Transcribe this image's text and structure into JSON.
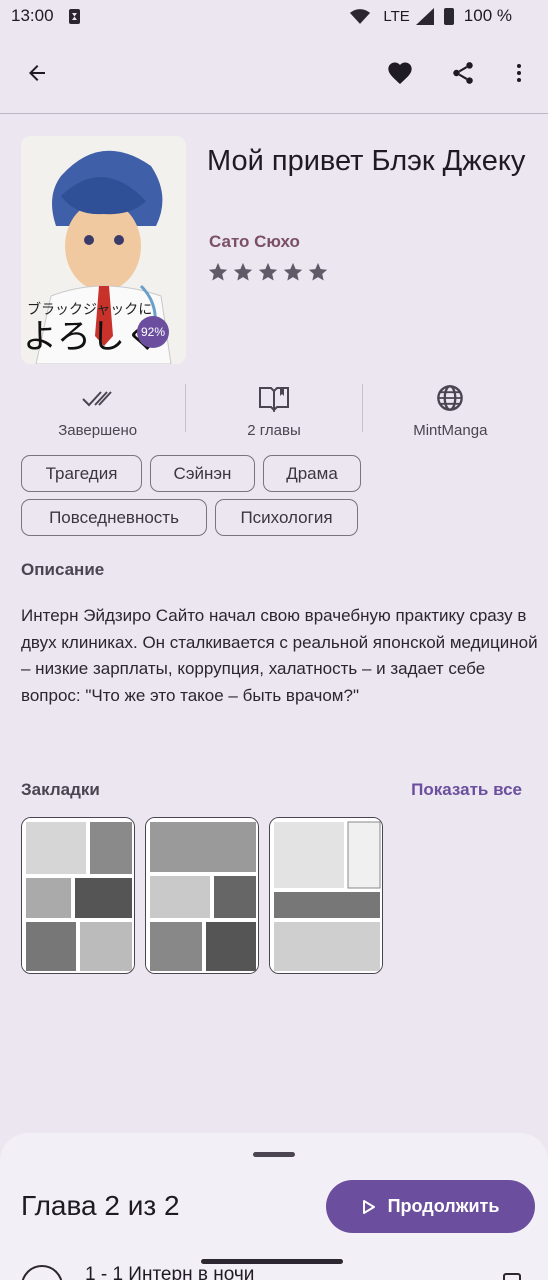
{
  "status_bar": {
    "time": "13:00",
    "network": "LTE",
    "battery": "100 %"
  },
  "app_bar": {
    "icons": [
      "back-arrow-icon",
      "heart-icon",
      "share-icon",
      "more-vert-icon"
    ]
  },
  "manga": {
    "title": "Мой привет Блэк Джеку",
    "author": "Сато Сюхо",
    "rating_stars": 5,
    "read_progress": "92%",
    "cover_text_line1": "ブラックジャックに",
    "cover_text_line2": "よろしく"
  },
  "info": [
    {
      "icon": "double-check-icon",
      "label": "Завершено"
    },
    {
      "icon": "book-icon",
      "label": "2 главы"
    },
    {
      "icon": "globe-icon",
      "label": "MintManga"
    }
  ],
  "genres": [
    "Трагедия",
    "Сэйнэн",
    "Драма",
    "Повседневность",
    "Психология"
  ],
  "description": {
    "label": "Описание",
    "text": "Интерн Эйдзиро Сайто начал свою врачебную практику сразу в двух клиниках. Он сталкивается с реальной японской медициной – низкие зарплаты, коррупция, халатность – и задает себе вопрос: \"Что же это такое – быть врачом?\""
  },
  "bookmarks": {
    "label": "Закладки",
    "show_all": "Показать все",
    "count": 3
  },
  "bottom_sheet": {
    "chapter_count": "Глава 2 из 2",
    "continue_label": "Продолжить",
    "first_chapter": "1 - 1 Интерн в ночи"
  },
  "colors": {
    "background": "#ebe6ef",
    "accent": "#6b4f9e",
    "author": "#7b5067",
    "sheet": "#f3eff6"
  }
}
